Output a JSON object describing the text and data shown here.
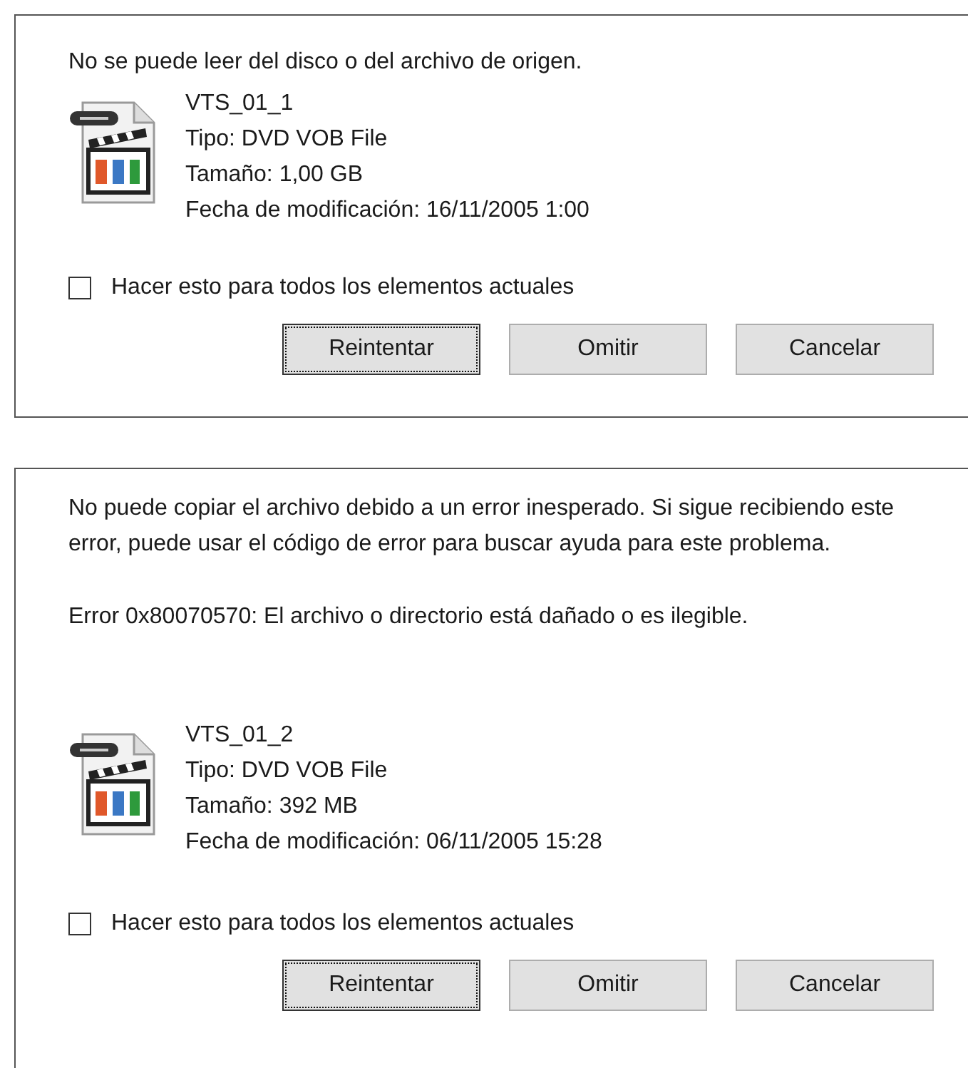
{
  "dialogs": [
    {
      "message": [
        "No se puede leer del disco o del archivo de origen."
      ],
      "file": {
        "name": "VTS_01_1",
        "type": "Tipo: DVD VOB File",
        "size": "Tamaño: 1,00 GB",
        "modified": "Fecha de modificación: 16/11/2005 1:00"
      },
      "checkbox": {
        "label": "Hacer esto para todos los elementos actuales",
        "checked": false
      },
      "buttons": [
        {
          "label": "Reintentar",
          "focused": true
        },
        {
          "label": "Omitir",
          "focused": false
        },
        {
          "label": "Cancelar",
          "focused": false
        }
      ]
    },
    {
      "message": [
        "No puede copiar el archivo debido a un error inesperado. Si sigue recibiendo este error, puede usar el código de error para buscar ayuda para este problema.",
        "Error 0x80070570: El archivo o directorio está dañado o es ilegible."
      ],
      "file": {
        "name": "VTS_01_2",
        "type": "Tipo: DVD VOB File",
        "size": "Tamaño: 392 MB",
        "modified": "Fecha de modificación: 06/11/2005 15:28"
      },
      "checkbox": {
        "label": "Hacer esto para todos los elementos actuales",
        "checked": false
      },
      "buttons": [
        {
          "label": "Reintentar",
          "focused": true
        },
        {
          "label": "Omitir",
          "focused": false
        },
        {
          "label": "Cancelar",
          "focused": false
        }
      ]
    }
  ]
}
